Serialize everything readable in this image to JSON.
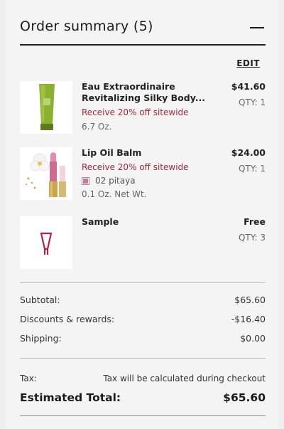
{
  "header": {
    "title": "Order summary (5)"
  },
  "edit_label": "EDIT",
  "items": [
    {
      "name_line1": "Eau Extraordinaire",
      "name_line2": "Revitalizing Silky Body...",
      "promo": "Receive 20% off sitewide",
      "size": "6.7 Oz.",
      "price": "$41.60",
      "qty": "QTY: 1"
    },
    {
      "name": "Lip Oil Balm",
      "promo": "Receive 20% off sitewide",
      "shade": "02 pitaya",
      "size": "0.1 Oz. Net Wt.",
      "price": "$24.00",
      "qty": "QTY: 1",
      "shade_color": "#c77b9b"
    },
    {
      "name": "Sample",
      "price": "Free",
      "qty": "QTY: 3"
    }
  ],
  "totals": {
    "subtotal_label": "Subtotal:",
    "subtotal_value": "$65.60",
    "discounts_label": "Discounts & rewards:",
    "discounts_value": "-$16.40",
    "shipping_label": "Shipping:",
    "shipping_value": "$0.00",
    "tax_label": "Tax:",
    "tax_note": "Tax will be calculated during checkout",
    "estimated_label": "Estimated Total:",
    "estimated_value": "$65.60"
  },
  "colors": {
    "promo": "#a3283f",
    "accent_dark": "#1a1a1a"
  }
}
